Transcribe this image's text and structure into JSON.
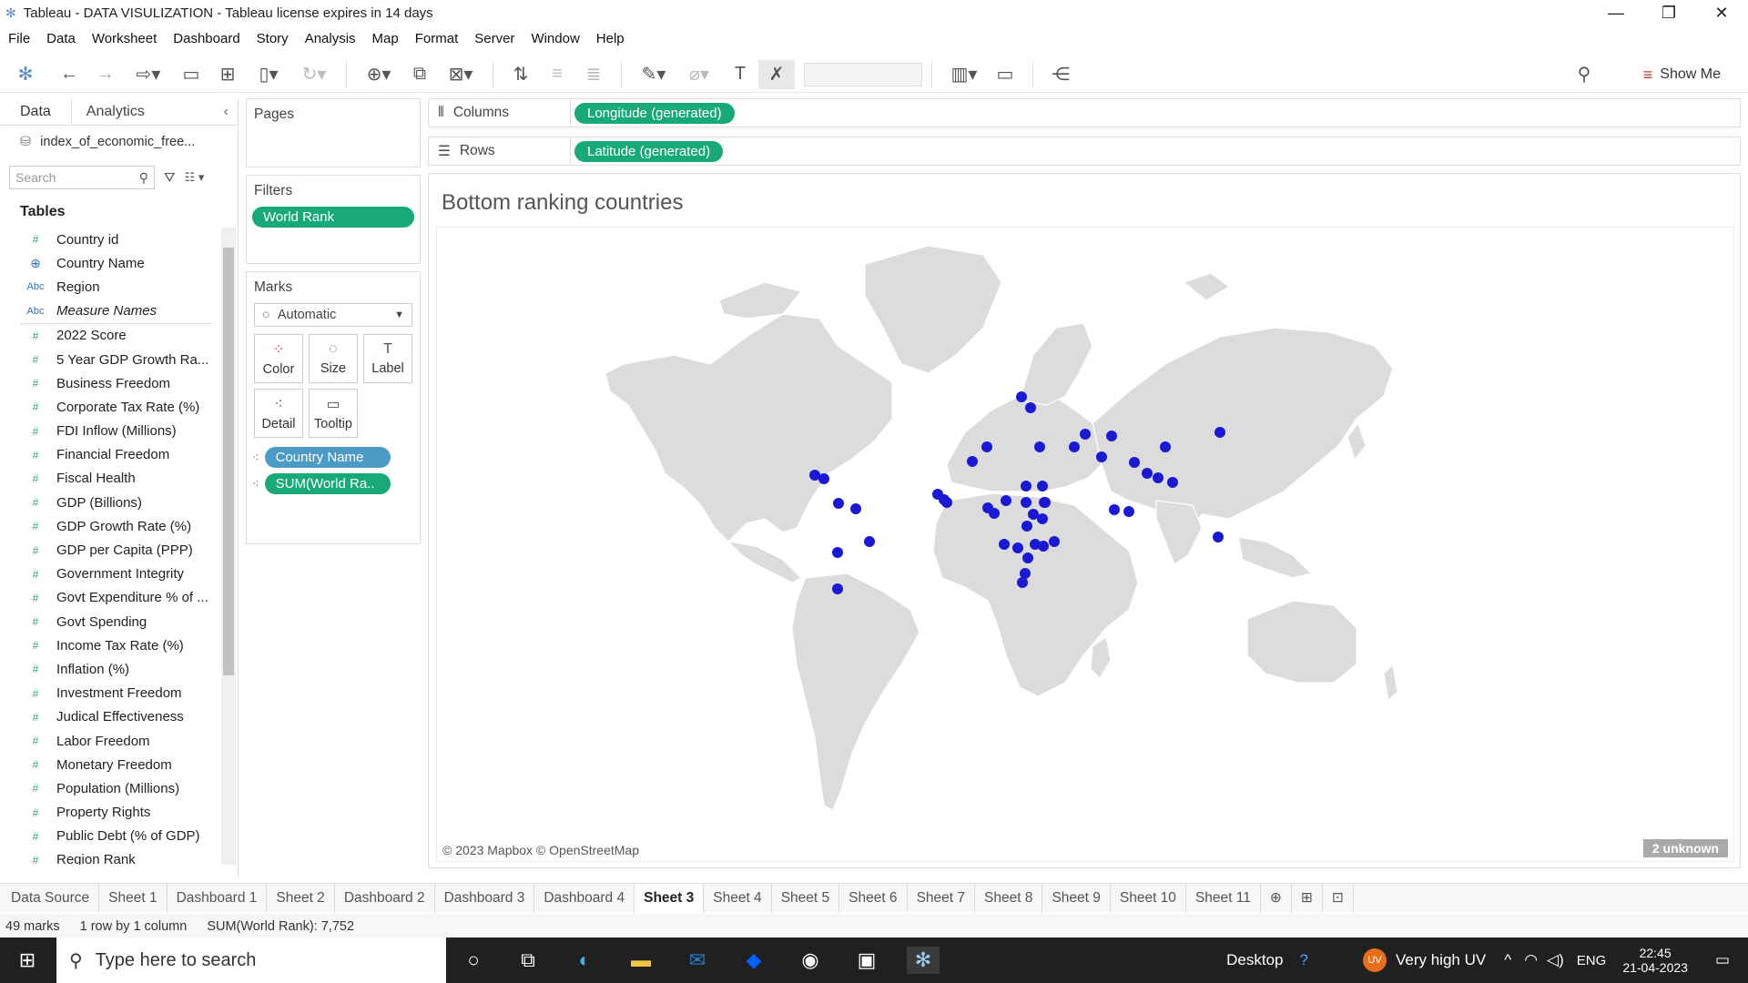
{
  "window": {
    "title": "Tableau - DATA VISULIZATION - Tableau license expires in 14 days"
  },
  "menu": [
    "File",
    "Data",
    "Worksheet",
    "Dashboard",
    "Story",
    "Analysis",
    "Map",
    "Format",
    "Server",
    "Window",
    "Help"
  ],
  "toolbar": {
    "show_me": "Show Me"
  },
  "left_panel": {
    "tab_data": "Data",
    "tab_analytics": "Analytics",
    "data_source": "index_of_economic_free...",
    "search_placeholder": "Search",
    "tables_heading": "Tables",
    "fields_top": [
      {
        "icon": "#",
        "label": "Country id"
      },
      {
        "icon": "globe",
        "label": "Country Name"
      },
      {
        "icon": "Abc",
        "label": "Region"
      },
      {
        "icon": "Abc",
        "label": "Measure Names"
      }
    ],
    "fields": [
      {
        "icon": "#",
        "label": "2022 Score"
      },
      {
        "icon": "#",
        "label": "5 Year GDP Growth Ra..."
      },
      {
        "icon": "#",
        "label": "Business Freedom"
      },
      {
        "icon": "#",
        "label": "Corporate Tax Rate (%)"
      },
      {
        "icon": "#",
        "label": "FDI Inflow (Millions)"
      },
      {
        "icon": "#",
        "label": "Financial Freedom"
      },
      {
        "icon": "#",
        "label": "Fiscal Health"
      },
      {
        "icon": "#",
        "label": "GDP (Billions)"
      },
      {
        "icon": "#",
        "label": "GDP Growth Rate (%)"
      },
      {
        "icon": "#",
        "label": "GDP per Capita (PPP)"
      },
      {
        "icon": "#",
        "label": "Government Integrity"
      },
      {
        "icon": "#",
        "label": "Govt Expenditure % of ..."
      },
      {
        "icon": "#",
        "label": "Govt Spending"
      },
      {
        "icon": "#",
        "label": "Income Tax Rate (%)"
      },
      {
        "icon": "#",
        "label": "Inflation (%)"
      },
      {
        "icon": "#",
        "label": "Investment Freedom"
      },
      {
        "icon": "#",
        "label": "Judical Effectiveness"
      },
      {
        "icon": "#",
        "label": "Labor Freedom"
      },
      {
        "icon": "#",
        "label": "Monetary Freedom"
      },
      {
        "icon": "#",
        "label": "Population (Millions)"
      },
      {
        "icon": "#",
        "label": "Property Rights"
      },
      {
        "icon": "#",
        "label": "Public Debt (% of GDP)"
      },
      {
        "icon": "#",
        "label": "Region Rank"
      }
    ]
  },
  "pages": {
    "label": "Pages"
  },
  "filters": {
    "label": "Filters",
    "pill": "World Rank"
  },
  "marks": {
    "label": "Marks",
    "type": "Automatic",
    "buttons": [
      "Color",
      "Size",
      "Label",
      "Detail",
      "Tooltip"
    ],
    "pills": [
      "Country Name",
      "SUM(World Ra.."
    ]
  },
  "shelves": {
    "columns_label": "Columns",
    "columns_pill": "Longitude (generated)",
    "rows_label": "Rows",
    "rows_pill": "Latitude (generated)"
  },
  "viz": {
    "title": "Bottom ranking countries",
    "attribution": "© 2023 Mapbox © OpenStreetMap",
    "unknown": "2 unknown",
    "mark_color": "#1a1ad6"
  },
  "sheet_tabs": [
    "Data Source",
    "Sheet 1",
    "Dashboard 1",
    "Sheet 2",
    "Dashboard 2",
    "Dashboard 3",
    "Dashboard 4",
    "Sheet 3",
    "Sheet 4",
    "Sheet 5",
    "Sheet 6",
    "Sheet 7",
    "Sheet 8",
    "Sheet 9",
    "Sheet 10",
    "Sheet 11"
  ],
  "active_sheet": "Sheet 3",
  "status": {
    "marks": "49 marks",
    "rows": "1 row by 1 column",
    "sum": "SUM(World Rank): 7,752"
  },
  "taskbar": {
    "search": "Type here to search",
    "desktop": "Desktop",
    "uv": "Very high UV",
    "lang": "ENG",
    "time": "22:45",
    "date": "21-04-2023"
  }
}
